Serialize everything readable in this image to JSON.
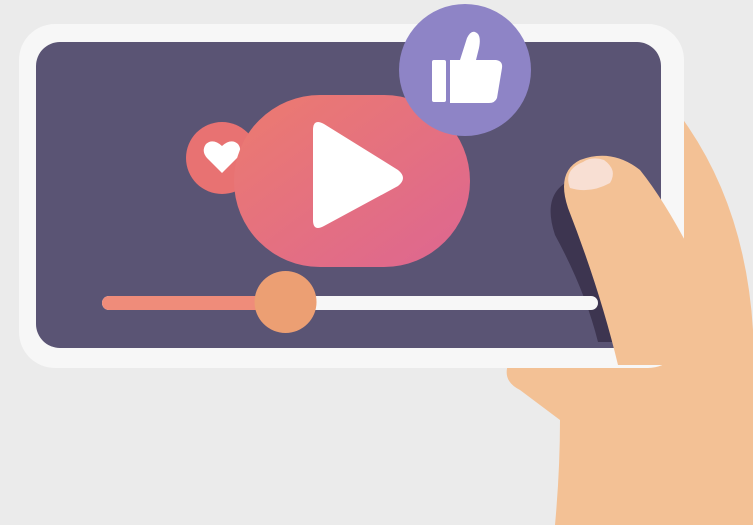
{
  "colors": {
    "background": "#ebebeb",
    "phone_frame": "#f7f7f7",
    "screen": "#5a5474",
    "play_gradient_start": "#ec7b6f",
    "play_gradient_end": "#dd6691",
    "heart_bubble": "#e87272",
    "like_badge": "#8e84c6",
    "progress_played": "#ef8c7a",
    "progress_track": "#f7f7f7",
    "progress_knob": "#ec9f73",
    "skin": "#f3c195",
    "nail": "#f8dfd3",
    "hand_shadow": "#3d3550"
  },
  "icons": {
    "play": "play-icon",
    "heart": "heart-icon",
    "like": "thumbs-up-icon"
  },
  "video": {
    "progress": 0.37
  }
}
